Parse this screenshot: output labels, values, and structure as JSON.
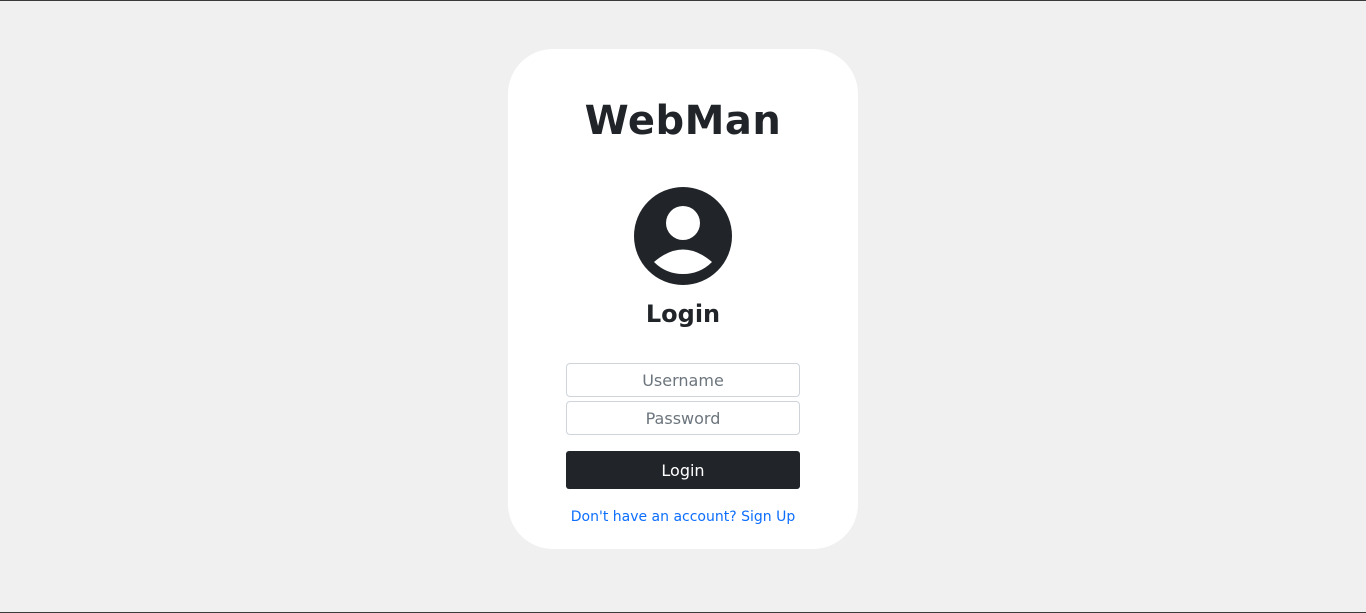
{
  "brand": {
    "title": "WebMan"
  },
  "login_form": {
    "avatar_icon": "user-circle-icon",
    "heading": "Login",
    "username_placeholder": "Username",
    "username_value": "",
    "password_placeholder": "Password",
    "password_value": "",
    "submit_label": "Login",
    "signup_link_text": "Don't have an account? Sign Up"
  },
  "colors": {
    "background": "#f0f0f0",
    "card": "#ffffff",
    "dark": "#212529",
    "link": "#0d6efd"
  }
}
